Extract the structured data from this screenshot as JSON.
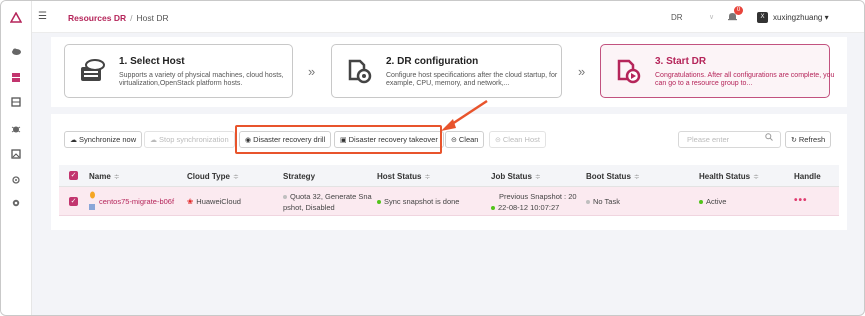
{
  "header": {
    "breadcrumb_root": "Resources DR",
    "breadcrumb_sep": "/",
    "breadcrumb_current": "Host DR",
    "region": "DR",
    "notification_count": "0",
    "user_avatar": "X",
    "username": "xuxingzhuang"
  },
  "steps": [
    {
      "title": "1. Select Host",
      "desc": "Supports a variety of physical machines, cloud hosts, virtualization,OpenStack platform hosts."
    },
    {
      "title": "2. DR configuration",
      "desc": "Configure host specifications after the cloud startup, for example, CPU, memory, and network,..."
    },
    {
      "title": "3. Start DR",
      "desc": "Congratulations. After all configurations are complete, you can go to a resource group to..."
    }
  ],
  "toolbar": {
    "sync_now": "Synchronize now",
    "stop_sync": "Stop synchronization",
    "dr_drill": "Disaster recovery drill",
    "dr_takeover": "Disaster recovery takeover",
    "clean": "Clean",
    "clean_host": "Clean Host",
    "search_placeholder": "Please enter",
    "refresh": "Refresh"
  },
  "table": {
    "columns": [
      "Name",
      "Cloud Type",
      "Strategy",
      "Host Status",
      "Job Status",
      "Boot Status",
      "Health Status",
      "Handle"
    ],
    "sort_glyph": "≑",
    "row": {
      "name": "centos75-migrate-b06f",
      "cloud_type": "HuaweiCloud",
      "strategy_line1": "Quota 32, Generate Sna",
      "strategy_line2": "pshot, Disabled",
      "host_status": "Sync snapshot is done",
      "job_status_line1": "Previous Snapshot : 20",
      "job_status_line2": "22-08-12 10:07:27",
      "boot_status": "No Task",
      "health_status": "Active",
      "handle": "•••"
    }
  },
  "colors": {
    "brand": "#b5255a",
    "accent_checkbox": "#c2356e",
    "highlight": "#e8542c",
    "status_green": "#52c41a",
    "status_grey": "#bfbfbf",
    "huawei_red": "#e02020"
  },
  "icons": [
    "cloud-icon",
    "database-icon",
    "server-icon",
    "bug-icon",
    "image-icon",
    "virus-icon",
    "gear-icon",
    "bell-icon",
    "hamburger-icon"
  ]
}
